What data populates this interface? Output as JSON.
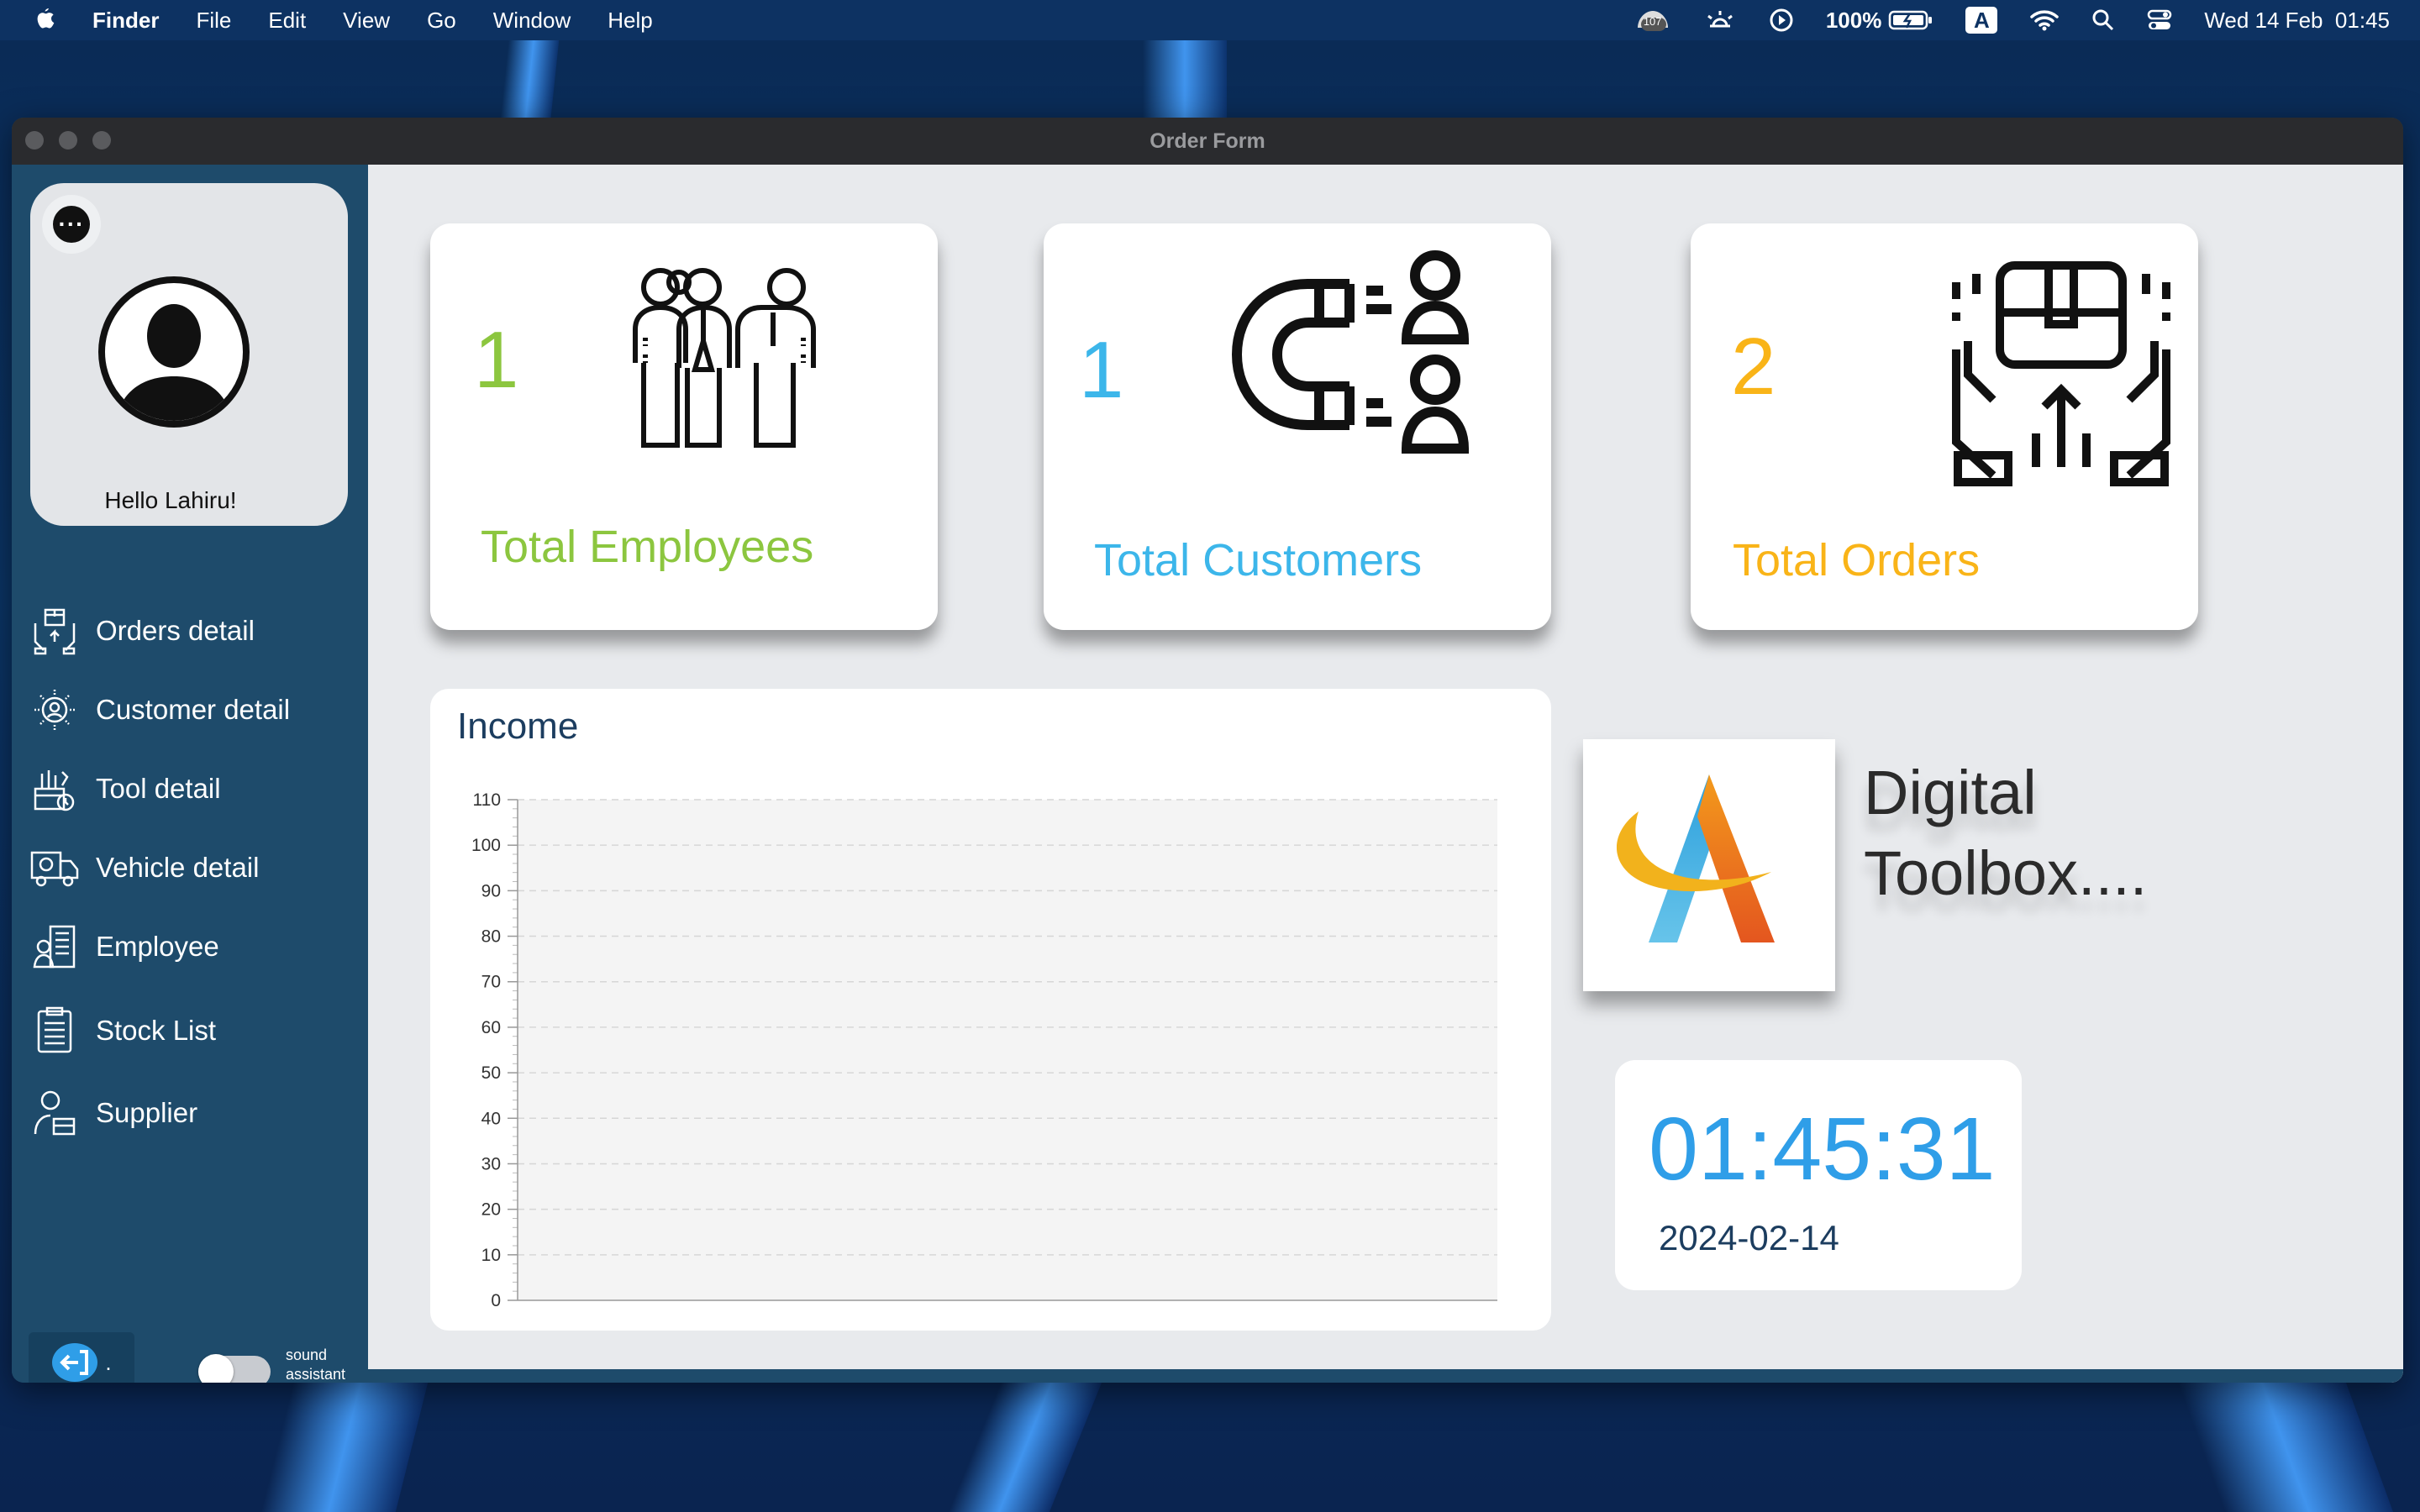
{
  "menubar": {
    "app": "Finder",
    "items": [
      "File",
      "Edit",
      "View",
      "Go",
      "Window",
      "Help"
    ],
    "battery": "100%",
    "input_source": "A",
    "notification_count": "107",
    "datetime": "Wed 14 Feb  01:45"
  },
  "window": {
    "title": "Order Form"
  },
  "profile": {
    "greeting": "Hello Lahiru!"
  },
  "sidebar": {
    "items": [
      {
        "label": "Orders detail",
        "icon": "orders-icon"
      },
      {
        "label": "Customer detail",
        "icon": "customer-icon"
      },
      {
        "label": "Tool detail",
        "icon": "tool-icon"
      },
      {
        "label": "Vehicle detail",
        "icon": "vehicle-icon"
      },
      {
        "label": "Employee",
        "icon": "employee-icon"
      },
      {
        "label": "Stock List",
        "icon": "stock-list-icon"
      },
      {
        "label": "Supplier",
        "icon": "supplier-icon"
      }
    ],
    "logout_suffix": ".",
    "sound_label_1": "sound",
    "sound_label_2": "assistant",
    "sound_assistant_on": false
  },
  "stats": {
    "employees": {
      "value": "1",
      "label": "Total Employees",
      "color": "#8cc63f"
    },
    "customers": {
      "value": "1",
      "label": "Total Customers",
      "color": "#3cb6ea"
    },
    "orders": {
      "value": "2",
      "label": "Total Orders",
      "color": "#f9b418"
    }
  },
  "income": {
    "title": "Income"
  },
  "chart_data": {
    "type": "line",
    "title": "Income",
    "series": [],
    "ylim": [
      0,
      110
    ],
    "yticks": [
      0,
      10,
      20,
      30,
      40,
      50,
      60,
      70,
      80,
      90,
      100,
      110
    ],
    "grid": true
  },
  "brand": {
    "line1": "Digital",
    "line2": "Toolbox...."
  },
  "clock": {
    "time": "01:45:31",
    "date": "2024-02-14"
  },
  "colors": {
    "sidebar": "#1e4b6b",
    "accent_blue": "#2f9ee8",
    "main_bg": "#e8eaed"
  }
}
